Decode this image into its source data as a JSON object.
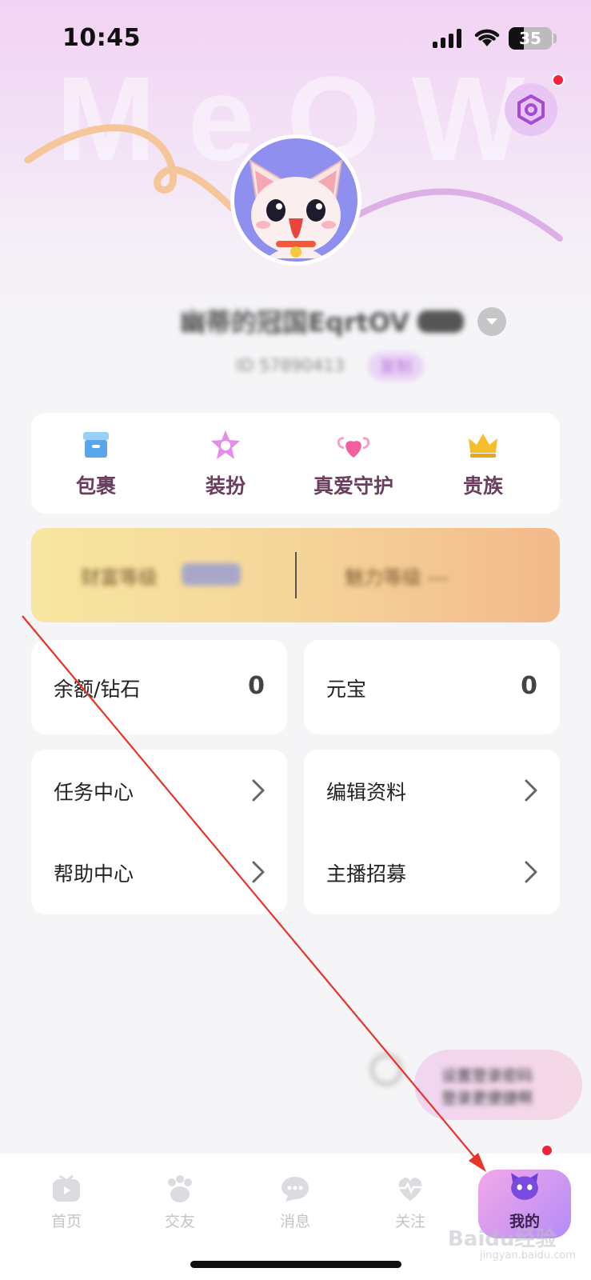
{
  "status_bar": {
    "time": "10:45",
    "battery": "35"
  },
  "header": {
    "decoration_text": "MeOW"
  },
  "profile": {
    "username": "幽蒂的冠国EqrtOV",
    "user_id": "ID 57890413",
    "copy_label": "复制"
  },
  "quick_menu": [
    {
      "label": "包裹",
      "icon": "package-icon"
    },
    {
      "label": "装扮",
      "icon": "star-dressup-icon"
    },
    {
      "label": "真爱守护",
      "icon": "winged-heart-icon"
    },
    {
      "label": "贵族",
      "icon": "crown-icon"
    }
  ],
  "wealth_banner": {
    "left_text": "财富等级",
    "right_text": "魅力等级 ---"
  },
  "balances": [
    {
      "label": "余额/钻石",
      "value": "0"
    },
    {
      "label": "元宝",
      "value": "0"
    }
  ],
  "menu_left": [
    {
      "label": "任务中心"
    },
    {
      "label": "帮助中心"
    }
  ],
  "menu_right": [
    {
      "label": "编辑资料"
    },
    {
      "label": "主播招募"
    }
  ],
  "float_promo": {
    "line1": "设置登录密码",
    "line2": "登录更便捷啊"
  },
  "tabs": [
    {
      "label": "首页",
      "icon": "home-tv-icon"
    },
    {
      "label": "交友",
      "icon": "paw-icon"
    },
    {
      "label": "消息",
      "icon": "chat-bubble-icon"
    },
    {
      "label": "关注",
      "icon": "heart-pulse-icon"
    },
    {
      "label": "我的",
      "icon": "cat-avatar-icon"
    }
  ],
  "watermark": {
    "brand": "Baidu经验",
    "url": "jingyan.baidu.com"
  },
  "colors": {
    "accent_pink": "#f3a8e8",
    "accent_purple": "#b48cf7",
    "badge_red": "#f0233a",
    "annotation_red": "#e8332a"
  }
}
